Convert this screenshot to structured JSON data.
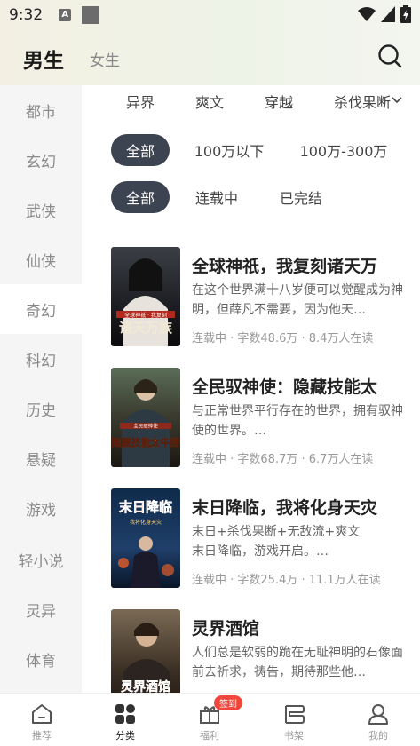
{
  "status_bar": {
    "time": "9:32",
    "a_icon": "A"
  },
  "header": {
    "tab_male": "男生",
    "tab_female": "女生"
  },
  "sidebar": {
    "items": [
      {
        "label": "都市"
      },
      {
        "label": "玄幻"
      },
      {
        "label": "武侠"
      },
      {
        "label": "仙侠"
      },
      {
        "label": "奇幻"
      },
      {
        "label": "科幻"
      },
      {
        "label": "历史"
      },
      {
        "label": "悬疑"
      },
      {
        "label": "游戏"
      },
      {
        "label": "轻小说"
      },
      {
        "label": "灵异"
      },
      {
        "label": "体育"
      }
    ],
    "active_index": 4
  },
  "subcategories": [
    "异界",
    "爽文",
    "穿越",
    "杀伐果断"
  ],
  "filters": {
    "word_count": [
      "全部",
      "100万以下",
      "100万-300万"
    ],
    "status": [
      "全部",
      "连载中",
      "已完结"
    ]
  },
  "books": [
    {
      "title": "全球神祇，我复刻诸天万",
      "desc": "在这个世界满十八岁便可以觉醒成为神明，但薛凡不需要，因为他天…",
      "meta": "连载中 · 字数48.6万 · 8.4万人在读",
      "cover_text": "诸天万族",
      "cover_sub": "全球神祇 · 我复刻"
    },
    {
      "title": "全民驭神使：隐藏技能太",
      "desc": "与正常世界平行存在的世界，拥有驭神使的世界。…",
      "meta": "连载中 · 字数68.7万 · 6.7万人在读",
      "cover_text": "隐藏技能太牛掰",
      "cover_sub": "全民驭神使"
    },
    {
      "title": "末日降临，我将化身天灾",
      "desc": "末日+杀伐果断+无敌流+爽文\n末日降临，游戏开启。…",
      "meta": "连载中 · 字数25.4万 · 11.1万人在读",
      "cover_text": "末日降临",
      "cover_sub": "我将化身天灾"
    },
    {
      "title": "灵界酒馆",
      "desc": "人们总是软弱的跪在无耻神明的石像面前去祈求，祷告，期待那些他…",
      "meta": "",
      "cover_text": "灵界酒馆",
      "cover_sub": ""
    }
  ],
  "bottom_nav": {
    "items": [
      {
        "label": "推荐",
        "icon": "home-icon"
      },
      {
        "label": "分类",
        "icon": "category-icon"
      },
      {
        "label": "福利",
        "icon": "gift-icon"
      },
      {
        "label": "书架",
        "icon": "bookshelf-icon"
      },
      {
        "label": "我的",
        "icon": "profile-icon"
      }
    ],
    "active_index": 1,
    "badge": "签到"
  },
  "colors": {
    "pill_active": "#3c4452",
    "badge": "#f0463c",
    "sidebar_bg": "#f5f5f5"
  }
}
